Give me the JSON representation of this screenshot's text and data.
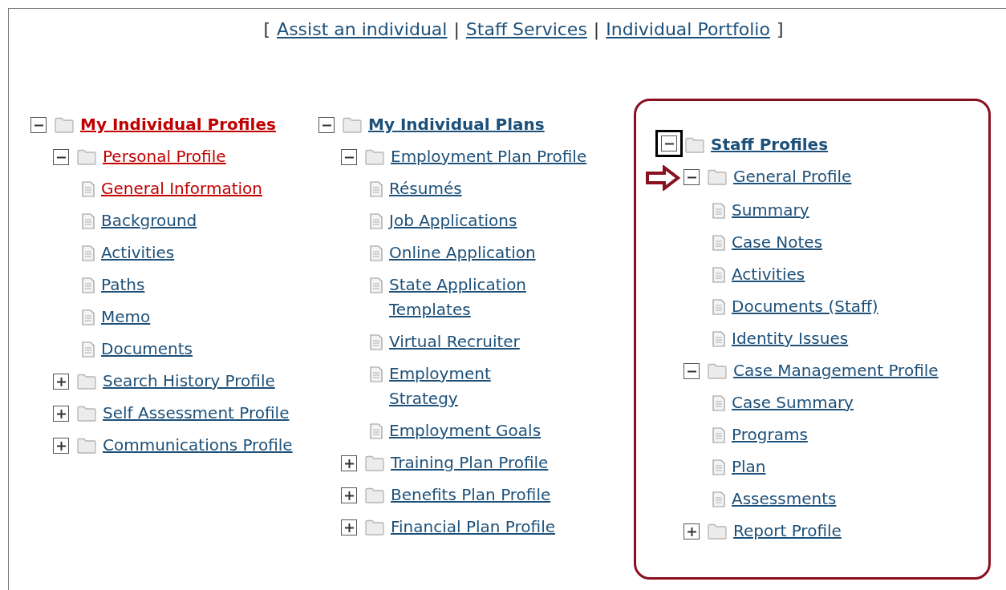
{
  "nav": [
    {
      "kind": "bracket",
      "text": "["
    },
    {
      "kind": "link",
      "text": "Assist an individual"
    },
    {
      "kind": "separator",
      "text": "|"
    },
    {
      "kind": "link",
      "text": "Staff Services"
    },
    {
      "kind": "separator",
      "text": "|"
    },
    {
      "kind": "link",
      "text": "Individual Portfolio"
    },
    {
      "kind": "bracket",
      "text": "]"
    }
  ],
  "columns": [
    {
      "highlighted": false,
      "root": {
        "kind": "folder",
        "label": "My Individual Profiles",
        "expanded": true,
        "current": true,
        "children": [
          {
            "kind": "folder",
            "label": "Personal Profile",
            "expanded": true,
            "current": true,
            "children": [
              {
                "kind": "page",
                "label": "General Information",
                "current": true
              },
              {
                "kind": "page",
                "label": "Background",
                "current": false
              },
              {
                "kind": "page",
                "label": "Activities",
                "current": false
              },
              {
                "kind": "page",
                "label": "Paths",
                "current": false
              },
              {
                "kind": "page",
                "label": "Memo",
                "current": false
              },
              {
                "kind": "page",
                "label": "Documents",
                "current": false
              }
            ]
          },
          {
            "kind": "folder",
            "label": "Search History Profile",
            "expanded": false,
            "current": false
          },
          {
            "kind": "folder",
            "label": "Self Assessment Profile",
            "expanded": false,
            "current": false
          },
          {
            "kind": "folder",
            "label": "Communications Profile",
            "expanded": false,
            "current": false
          }
        ]
      }
    },
    {
      "highlighted": false,
      "root": {
        "kind": "folder",
        "label": "My Individual Plans",
        "expanded": true,
        "current": false,
        "children": [
          {
            "kind": "folder",
            "label": "Employment Plan Profile",
            "expanded": true,
            "current": false,
            "children": [
              {
                "kind": "page",
                "label": "Résumés",
                "current": false
              },
              {
                "kind": "page",
                "label": "Job Applications",
                "current": false
              },
              {
                "kind": "page",
                "label": "Online Application",
                "current": false
              },
              {
                "kind": "page",
                "label": "State Application Templates",
                "current": false
              },
              {
                "kind": "page",
                "label": "Virtual Recruiter",
                "current": false
              },
              {
                "kind": "page",
                "label": "Employment Strategy",
                "current": false
              },
              {
                "kind": "page",
                "label": "Employment Goals",
                "current": false
              }
            ]
          },
          {
            "kind": "folder",
            "label": "Training Plan Profile",
            "expanded": false,
            "current": false
          },
          {
            "kind": "folder",
            "label": "Benefits Plan Profile",
            "expanded": false,
            "current": false
          },
          {
            "kind": "folder",
            "label": "Financial Plan Profile",
            "expanded": false,
            "current": false
          }
        ]
      }
    },
    {
      "highlighted": true,
      "root": {
        "kind": "folder",
        "label": "Staff Profiles",
        "expanded": true,
        "current": false,
        "toggle_highlighted": true,
        "children": [
          {
            "kind": "folder",
            "label": "General Profile",
            "expanded": true,
            "current": false,
            "arrow_marker": true,
            "children": [
              {
                "kind": "page",
                "label": "Summary",
                "current": false
              },
              {
                "kind": "page",
                "label": "Case Notes",
                "current": false
              },
              {
                "kind": "page",
                "label": "Activities",
                "current": false
              },
              {
                "kind": "page",
                "label": "Documents (Staff)",
                "current": false
              },
              {
                "kind": "page",
                "label": "Identity Issues",
                "current": false
              }
            ]
          },
          {
            "kind": "folder",
            "label": "Case Management Profile",
            "expanded": true,
            "current": false,
            "children": [
              {
                "kind": "page",
                "label": "Case Summary",
                "current": false
              },
              {
                "kind": "page",
                "label": "Programs",
                "current": false
              },
              {
                "kind": "page",
                "label": "Plan",
                "current": false
              },
              {
                "kind": "page",
                "label": "Assessments",
                "current": false
              }
            ]
          },
          {
            "kind": "folder",
            "label": "Report Profile",
            "expanded": false,
            "current": false
          }
        ]
      }
    }
  ]
}
